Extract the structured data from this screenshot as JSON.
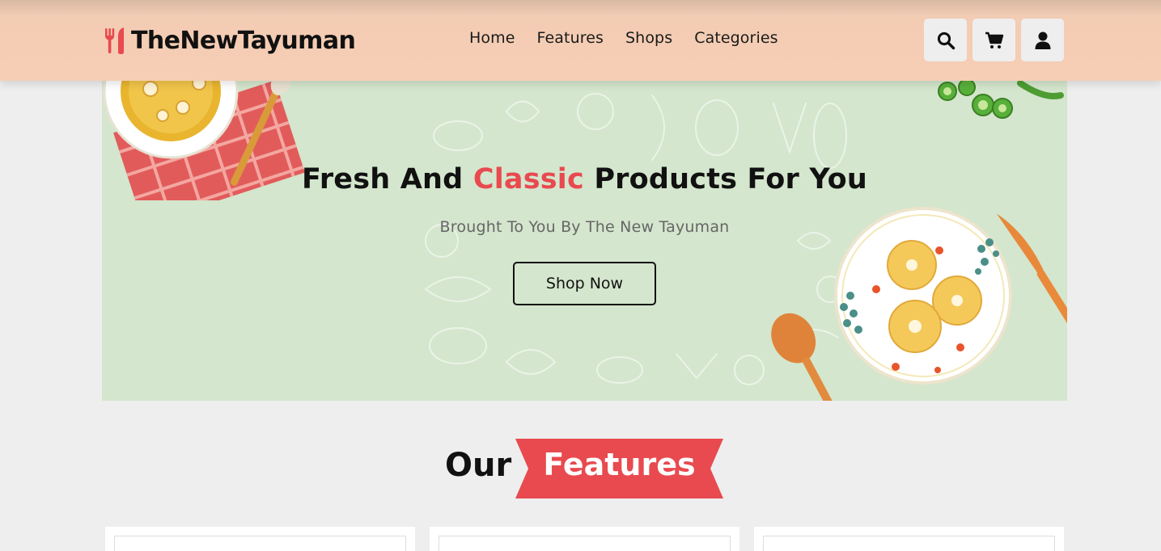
{
  "header": {
    "logo_text": "TheNewTayuman",
    "logo_icon": "utensils-icon",
    "nav": [
      {
        "label": "Home"
      },
      {
        "label": "Features"
      },
      {
        "label": "Shops"
      },
      {
        "label": "Categories"
      }
    ],
    "icons": [
      "search-icon",
      "cart-icon",
      "user-icon"
    ]
  },
  "hero": {
    "title_before": "Fresh And ",
    "title_accent": "Classic",
    "title_after": " Products For You",
    "subtitle": "Brought To You By The New Tayuman",
    "button_label": "Shop Now"
  },
  "features": {
    "heading_our": "Our",
    "heading_accent": "Features"
  },
  "colors": {
    "accent": "#e84a4f",
    "header_bg": "#f6ceb5",
    "hero_bg": "#d4e6cd",
    "page_bg": "#eeeeee"
  }
}
